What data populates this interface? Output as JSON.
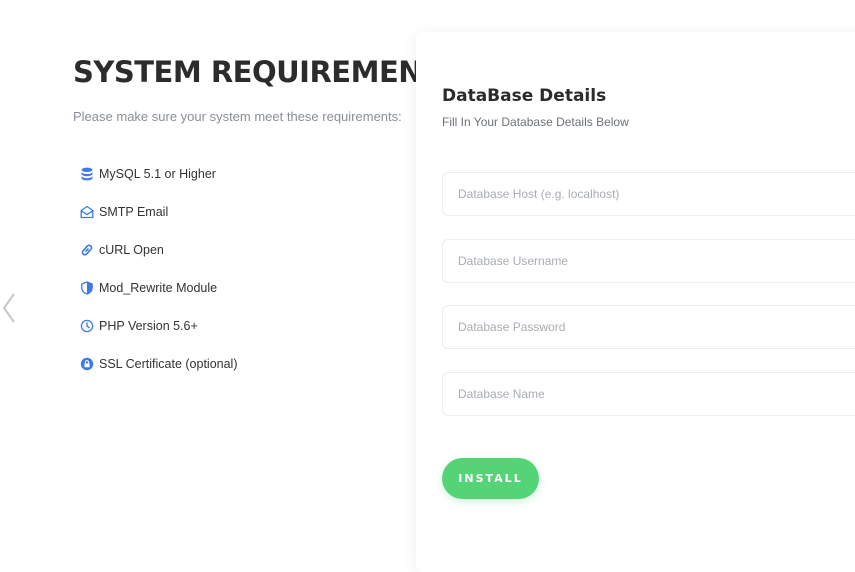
{
  "requirements": {
    "title": "SYSTEM REQUIREMENTS",
    "subtitle": "Please make sure your system meet these requirements:",
    "icon_color": "#3d7be8",
    "items": [
      {
        "label": "MySQL 5.1 or Higher",
        "icon": "database-icon"
      },
      {
        "label": "SMTP Email",
        "icon": "envelope-open-icon"
      },
      {
        "label": "cURL Open",
        "icon": "link-icon"
      },
      {
        "label": "Mod_Rewrite Module",
        "icon": "shield-icon"
      },
      {
        "label": "PHP Version 5.6+",
        "icon": "clock-icon"
      },
      {
        "label": "SSL Certificate (optional)",
        "icon": "lock-icon"
      }
    ]
  },
  "database": {
    "title": "DataBase Details",
    "subtitle": "Fill In Your Database Details Below",
    "fields": [
      {
        "placeholder": "Database Host (e.g. localhost)",
        "value": ""
      },
      {
        "placeholder": "Database Username",
        "value": ""
      },
      {
        "placeholder": "Database Password",
        "value": ""
      },
      {
        "placeholder": "Database Name",
        "value": ""
      }
    ],
    "install_label": "INSTALL",
    "accent": "#55d477"
  }
}
